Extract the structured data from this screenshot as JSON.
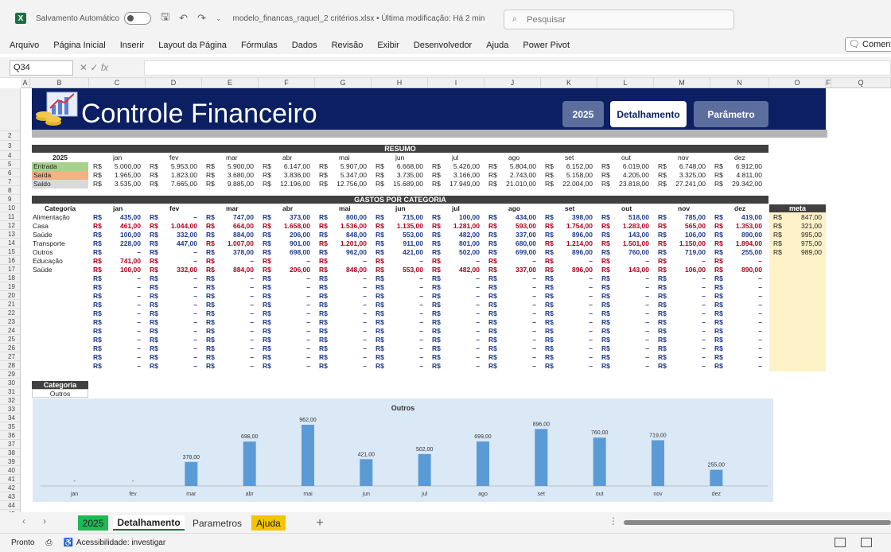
{
  "titlebar": {
    "autosave_label": "Salvamento Automático",
    "filename": "modelo_financas_raquel_2 critérios.xlsx • Última modificação: Há 2 min",
    "search_placeholder": "Pesquisar"
  },
  "menu": [
    "Arquivo",
    "Página Inicial",
    "Inserir",
    "Layout da Página",
    "Fórmulas",
    "Dados",
    "Revisão",
    "Exibir",
    "Desenvolvedor",
    "Ajuda",
    "Power Pivot"
  ],
  "comment_label": "Comentá",
  "formula": {
    "namebox": "Q34",
    "fx": "fx",
    "value": ""
  },
  "columns": [
    "A",
    "B",
    "C",
    "D",
    "E",
    "F",
    "G",
    "H",
    "I",
    "J",
    "K",
    "L",
    "M",
    "N",
    "O",
    "F",
    "Q"
  ],
  "banner": {
    "title": "Controle Financeiro",
    "buttons": [
      "2025",
      "Detalhamento",
      "Parâmetro"
    ]
  },
  "resumo": {
    "title": "RESUMO",
    "year": "2025",
    "months": [
      "jan",
      "fev",
      "mar",
      "abr",
      "mai",
      "jun",
      "jul",
      "ago",
      "set",
      "out",
      "nov",
      "dez"
    ],
    "currency": "R$",
    "rows": [
      {
        "label": "Entrada",
        "color": "#a9d18e",
        "values": [
          "5.000,00",
          "5.953,00",
          "5.900,00",
          "6.147,00",
          "5.907,00",
          "6.668,00",
          "5.426,00",
          "5.804,00",
          "6.152,00",
          "6.019,00",
          "6.748,00",
          "6.912,00"
        ]
      },
      {
        "label": "Saída",
        "color": "#f4b183",
        "values": [
          "1.965,00",
          "1.823,00",
          "3.680,00",
          "3.836,00",
          "5.347,00",
          "3.735,00",
          "3.166,00",
          "2.743,00",
          "5.158,00",
          "4.205,00",
          "3.325,00",
          "4.811,00"
        ]
      },
      {
        "label": "Saldo",
        "color": "#d9d9d9",
        "values": [
          "3.535,00",
          "7.665,00",
          "9.885,00",
          "12.196,00",
          "12.756,00",
          "15.689,00",
          "17.949,00",
          "21.010,00",
          "22.004,00",
          "23.818,00",
          "27.241,00",
          "29.342,00"
        ]
      }
    ]
  },
  "gastos": {
    "title": "GASTOS POR CATEGORIA",
    "header": "Categoria",
    "rows": [
      {
        "label": "Alimentação",
        "style": "blue",
        "values": [
          "435,00",
          "–",
          "747,00",
          "373,00",
          "800,00",
          "715,00",
          "100,00",
          "434,00",
          "398,00",
          "518,00",
          "785,00",
          "419,00"
        ]
      },
      {
        "label": "Casa",
        "style": "red",
        "values": [
          "461,00",
          "1.044,00",
          "664,00",
          "1.658,00",
          "1.536,00",
          "1.135,00",
          "1.281,00",
          "593,00",
          "1.754,00",
          "1.283,00",
          "565,00",
          "1.353,00"
        ]
      },
      {
        "label": "Saúde",
        "style": "blue",
        "values": [
          "100,00",
          "332,00",
          "884,00",
          "206,00",
          "848,00",
          "553,00",
          "482,00",
          "337,00",
          "896,00",
          "143,00",
          "106,00",
          "890,00"
        ]
      },
      {
        "label": "Transporte",
        "style": "mixed",
        "values": [
          "228,00",
          "447,00",
          "1.007,00",
          "901,00",
          "1.201,00",
          "911,00",
          "801,00",
          "680,00",
          "1.214,00",
          "1.501,00",
          "1.150,00",
          "1.894,00"
        ]
      },
      {
        "label": "Outros",
        "style": "blue",
        "values": [
          "–",
          "–",
          "378,00",
          "698,00",
          "962,00",
          "421,00",
          "502,00",
          "699,00",
          "896,00",
          "760,00",
          "719,00",
          "255,00"
        ]
      },
      {
        "label": "Educação",
        "style": "red",
        "values": [
          "741,00",
          "–",
          "–",
          "–",
          "–",
          "–",
          "–",
          "–",
          "–",
          "–",
          "–",
          "–"
        ]
      },
      {
        "label": "Saúde",
        "style": "red",
        "values": [
          "100,00",
          "332,00",
          "884,00",
          "206,00",
          "848,00",
          "553,00",
          "482,00",
          "337,00",
          "896,00",
          "143,00",
          "106,00",
          "890,00"
        ]
      }
    ],
    "empty_value": "–"
  },
  "meta": {
    "header": "meta",
    "values": [
      "847,00",
      "321,00",
      "995,00",
      "975,00",
      "989,00"
    ]
  },
  "catsel": {
    "label": "Categoria",
    "value": "Outros"
  },
  "chart_data": {
    "type": "bar",
    "title": "Outros",
    "categories": [
      "jan",
      "fev",
      "mar",
      "abr",
      "mai",
      "jun",
      "jul",
      "ago",
      "set",
      "out",
      "nov",
      "dez"
    ],
    "values": [
      0,
      0,
      378,
      698,
      962,
      421,
      502,
      699,
      896,
      760,
      719,
      255
    ],
    "labels": [
      "-",
      "-",
      "378,00",
      "698,00",
      "962,00",
      "421,00",
      "502,00",
      "699,00",
      "896,00",
      "760,00",
      "719,00",
      "255,00"
    ],
    "color": "#5b9bd5",
    "ylim": [
      0,
      1000
    ]
  },
  "tabs": [
    "2025",
    "Detalhamento",
    "Parametros",
    "Ajuda"
  ],
  "status": {
    "ready": "Pronto",
    "accessibility": "Acessibilidade: investigar"
  }
}
